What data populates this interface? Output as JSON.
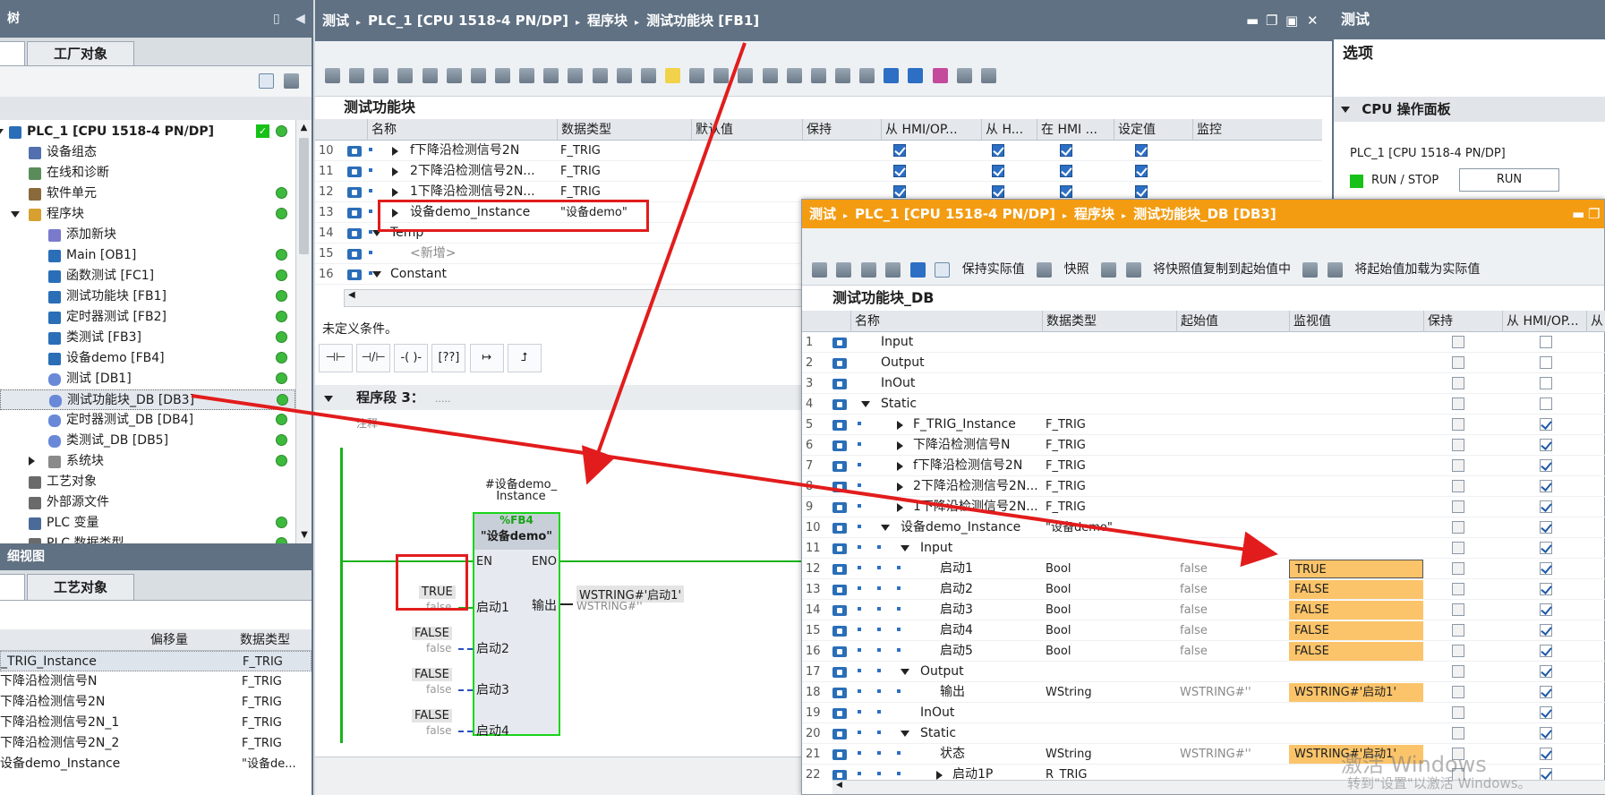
{
  "left_top": {
    "title_fragment": "树",
    "tab": "工厂对象",
    "tree": [
      {
        "label": "PLC_1 [CPU 1518-4 PN/DP]",
        "bold": true
      },
      {
        "label": "设备组态"
      },
      {
        "label": "在线和诊断"
      },
      {
        "label": "软件单元"
      },
      {
        "label": "程序块"
      },
      {
        "label": "添加新块"
      },
      {
        "label": "Main [OB1]"
      },
      {
        "label": "函数测试 [FC1]"
      },
      {
        "label": "测试功能块 [FB1]"
      },
      {
        "label": "定时器测试 [FB2]"
      },
      {
        "label": "类测试 [FB3]"
      },
      {
        "label": "设备demo [FB4]"
      },
      {
        "label": "测试 [DB1]"
      },
      {
        "label": "测试功能块_DB [DB3]"
      },
      {
        "label": "定时器测试_DB [DB4]"
      },
      {
        "label": "类测试_DB [DB5]"
      },
      {
        "label": "系统块"
      },
      {
        "label": "工艺对象"
      },
      {
        "label": "外部源文件"
      },
      {
        "label": "PLC 变量"
      },
      {
        "label": "PLC 数据类型"
      }
    ]
  },
  "left_bottom": {
    "title_fragment": "细视图",
    "tab": "工艺对象",
    "headers": [
      "偏移量",
      "数据类型"
    ],
    "rows": [
      {
        "name": "_TRIG_Instance",
        "type": "F_TRIG"
      },
      {
        "name": "下降沿检测信号N",
        "type": "F_TRIG"
      },
      {
        "name": "下降沿检测信号2N",
        "type": "F_TRIG"
      },
      {
        "name": "下降沿检测信号2N_1",
        "type": "F_TRIG"
      },
      {
        "name": "下降沿检测信号2N_2",
        "type": "F_TRIG"
      },
      {
        "name": "设备demo_Instance",
        "type": "\"设备de..."
      }
    ]
  },
  "editor": {
    "breadcrumb": [
      "测试",
      "PLC_1 [CPU 1518-4 PN/DP]",
      "程序块",
      "测试功能块 [FB1]"
    ],
    "block_title": "测试功能块",
    "headers": [
      "名称",
      "数据类型",
      "默认值",
      "保持",
      "从 HMI/OP...",
      "从 H...",
      "在 HMI ...",
      "设定值",
      "监控"
    ],
    "rows": [
      {
        "num": "10",
        "name": "f下降沿检测信号2N",
        "type": "F_TRIG",
        "expand": "right"
      },
      {
        "num": "11",
        "name": "2下降沿检测信号2N...",
        "type": "F_TRIG",
        "expand": "right"
      },
      {
        "num": "12",
        "name": "1下降沿检测信号2N...",
        "type": "F_TRIG",
        "expand": "right"
      },
      {
        "num": "13",
        "name": "设备demo_Instance",
        "type": "\"设备demo\"",
        "expand": "right"
      },
      {
        "num": "14",
        "name": "Temp",
        "type": "",
        "expand": "down"
      },
      {
        "num": "15",
        "name": "<新增>",
        "type": "",
        "expand": "none"
      },
      {
        "num": "16",
        "name": "Constant",
        "type": "",
        "expand": "down"
      }
    ],
    "condition": "未定义条件。",
    "network_title": "程序段 3：",
    "network_dots": ".....",
    "comment": "注释",
    "instance_label_1": "#设备demo_",
    "instance_label_2": "Instance",
    "fb_number": "%FB4",
    "fb_name": "\"设备demo\"",
    "en": "EN",
    "eno": "ENO",
    "inputs": [
      {
        "live": "TRUE",
        "init": "false",
        "pin": "启动1"
      },
      {
        "live": "FALSE",
        "init": "false",
        "pin": "启动2"
      },
      {
        "live": "FALSE",
        "init": "false",
        "pin": "启动3"
      },
      {
        "live": "FALSE",
        "init": "false",
        "pin": "启动4"
      }
    ],
    "output_pin": "输出",
    "output_live": "WSTRING#'启动1'",
    "output_init": "WSTRING#''"
  },
  "right_panel": {
    "title": "测试",
    "options": "选项",
    "section": "CPU 操作面板",
    "plc": "PLC_1 [CPU 1518-4 PN/DP]",
    "runstop": "RUN / STOP",
    "run_button": "RUN"
  },
  "db_window": {
    "breadcrumb": [
      "测试",
      "PLC_1 [CPU 1518-4 PN/DP]",
      "程序块",
      "测试功能块_DB [DB3]"
    ],
    "toolbar": {
      "keep_actual": "保持实际值",
      "snapshot": "快照",
      "copy_snapshot": "将快照值复制到起始值中",
      "load_start": "将起始值加载为实际值"
    },
    "db_title": "测试功能块_DB",
    "headers": [
      "名称",
      "数据类型",
      "起始值",
      "监视值",
      "保持",
      "从 HMI/OP...",
      "从"
    ],
    "rows": [
      {
        "num": "1",
        "indent": 0,
        "expand": "none",
        "name": "Input",
        "type": "",
        "start": "",
        "monitor": "",
        "hmi": false
      },
      {
        "num": "2",
        "indent": 0,
        "expand": "none",
        "name": "Output",
        "type": "",
        "start": "",
        "monitor": "",
        "hmi": false
      },
      {
        "num": "3",
        "indent": 0,
        "expand": "none",
        "name": "InOut",
        "type": "",
        "start": "",
        "monitor": "",
        "hmi": false
      },
      {
        "num": "4",
        "indent": 0,
        "expand": "down",
        "name": "Static",
        "type": "",
        "start": "",
        "monitor": "",
        "hmi": false
      },
      {
        "num": "5",
        "indent": 1,
        "expand": "right",
        "name": "F_TRIG_Instance",
        "type": "F_TRIG",
        "start": "",
        "monitor": "",
        "hmi": true
      },
      {
        "num": "6",
        "indent": 1,
        "expand": "right",
        "name": "下降沿检测信号N",
        "type": "F_TRIG",
        "start": "",
        "monitor": "",
        "hmi": true
      },
      {
        "num": "7",
        "indent": 1,
        "expand": "right",
        "name": "f下降沿检测信号2N",
        "type": "F_TRIG",
        "start": "",
        "monitor": "",
        "hmi": true
      },
      {
        "num": "8",
        "indent": 1,
        "expand": "right",
        "name": "2下降沿检测信号2N...",
        "type": "F_TRIG",
        "start": "",
        "monitor": "",
        "hmi": true
      },
      {
        "num": "9",
        "indent": 1,
        "expand": "right",
        "name": "1下降沿检测信号2N...",
        "type": "F_TRIG",
        "start": "",
        "monitor": "",
        "hmi": true
      },
      {
        "num": "10",
        "indent": 1,
        "expand": "down",
        "name": "设备demo_Instance",
        "type": "\"设备demo\"",
        "start": "",
        "monitor": "",
        "hmi": true
      },
      {
        "num": "11",
        "indent": 2,
        "expand": "down",
        "name": "Input",
        "type": "",
        "start": "",
        "monitor": "",
        "hmi": true
      },
      {
        "num": "12",
        "indent": 3,
        "expand": "none",
        "name": "启动1",
        "type": "Bool",
        "start": "false",
        "monitor": "TRUE",
        "hmi": true
      },
      {
        "num": "13",
        "indent": 3,
        "expand": "none",
        "name": "启动2",
        "type": "Bool",
        "start": "false",
        "monitor": "FALSE",
        "hmi": true
      },
      {
        "num": "14",
        "indent": 3,
        "expand": "none",
        "name": "启动3",
        "type": "Bool",
        "start": "false",
        "monitor": "FALSE",
        "hmi": true
      },
      {
        "num": "15",
        "indent": 3,
        "expand": "none",
        "name": "启动4",
        "type": "Bool",
        "start": "false",
        "monitor": "FALSE",
        "hmi": true
      },
      {
        "num": "16",
        "indent": 3,
        "expand": "none",
        "name": "启动5",
        "type": "Bool",
        "start": "false",
        "monitor": "FALSE",
        "hmi": true
      },
      {
        "num": "17",
        "indent": 2,
        "expand": "down",
        "name": "Output",
        "type": "",
        "start": "",
        "monitor": "",
        "hmi": true
      },
      {
        "num": "18",
        "indent": 3,
        "expand": "none",
        "name": "输出",
        "type": "WString",
        "start": "WSTRING#''",
        "monitor": "WSTRING#'启动1'",
        "hmi": true
      },
      {
        "num": "19",
        "indent": 2,
        "expand": "none",
        "name": "InOut",
        "type": "",
        "start": "",
        "monitor": "",
        "hmi": true
      },
      {
        "num": "20",
        "indent": 2,
        "expand": "down",
        "name": "Static",
        "type": "",
        "start": "",
        "monitor": "",
        "hmi": true
      },
      {
        "num": "21",
        "indent": 3,
        "expand": "none",
        "name": "状态",
        "type": "WString",
        "start": "WSTRING#''",
        "monitor": "WSTRING#'启动1'",
        "hmi": true
      },
      {
        "num": "22",
        "indent": 3,
        "expand": "right",
        "name": "启动1P",
        "type": "R_TRIG",
        "start": "",
        "monitor": "",
        "hmi": true
      }
    ]
  },
  "watermark": {
    "line1": "激活 Windows",
    "line2": "转到\"设置\"以激活 Windows。"
  },
  "colors": {
    "monitor_fill": "#fbc46a",
    "title_orange": "#f39c12",
    "status_green": "#3dba3d",
    "annotation_red": "#e21c1c"
  }
}
